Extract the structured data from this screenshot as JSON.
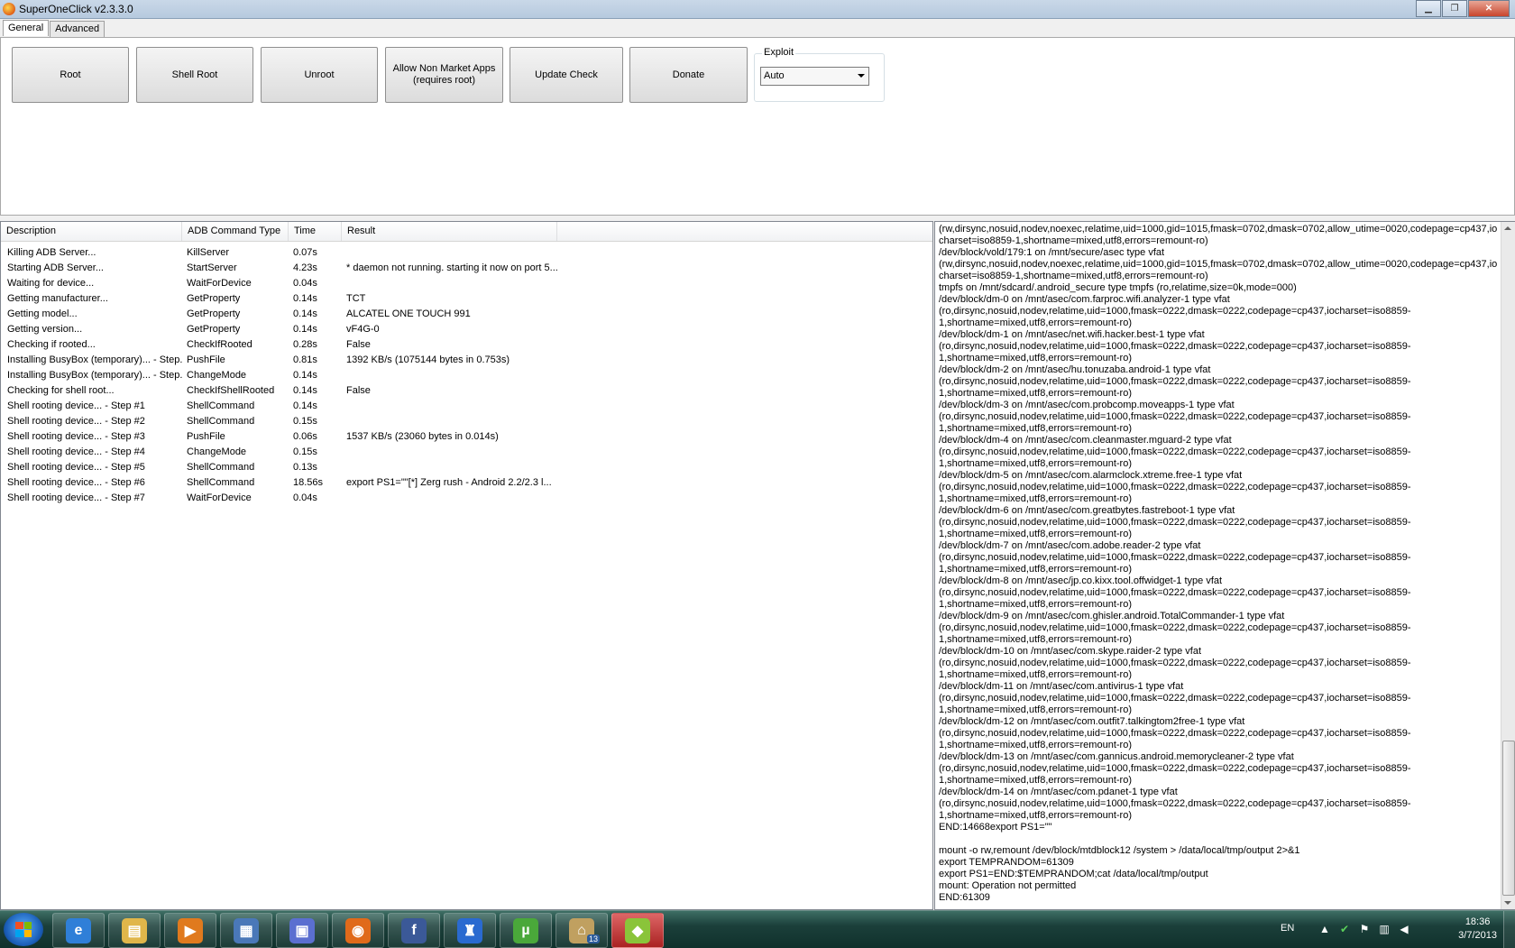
{
  "window": {
    "title": "SuperOneClick v2.3.3.0",
    "min_icon": "minimize-icon",
    "max_icon": "maximize-icon",
    "close_icon": "close-icon"
  },
  "tabs": [
    {
      "label": "General",
      "active": true
    },
    {
      "label": "Advanced",
      "active": false
    }
  ],
  "buttons": {
    "root": "Root",
    "shell_root": "Shell Root",
    "unroot": "Unroot",
    "allow_non_market_line1": "Allow Non Market Apps",
    "allow_non_market_line2": "(requires root)",
    "update_check": "Update Check",
    "donate": "Donate"
  },
  "exploit": {
    "label": "Exploit",
    "value": "Auto"
  },
  "listview": {
    "columns": [
      "Description",
      "ADB Command Type",
      "Time",
      "Result"
    ],
    "rows": [
      [
        "Killing ADB Server...",
        "KillServer",
        "0.07s",
        ""
      ],
      [
        "Starting ADB Server...",
        "StartServer",
        "4.23s",
        "* daemon not running. starting it now on port 5..."
      ],
      [
        "Waiting for device...",
        "WaitForDevice",
        "0.04s",
        ""
      ],
      [
        "Getting manufacturer...",
        "GetProperty",
        "0.14s",
        "TCT"
      ],
      [
        "Getting model...",
        "GetProperty",
        "0.14s",
        "ALCATEL ONE TOUCH 991"
      ],
      [
        "Getting version...",
        "GetProperty",
        "0.14s",
        "vF4G-0"
      ],
      [
        "Checking if rooted...",
        "CheckIfRooted",
        "0.28s",
        "False"
      ],
      [
        "Installing BusyBox (temporary)... - Step...",
        "PushFile",
        "0.81s",
        "1392 KB/s (1075144 bytes in 0.753s)"
      ],
      [
        "Installing BusyBox (temporary)... - Step...",
        "ChangeMode",
        "0.14s",
        ""
      ],
      [
        "Checking for shell root...",
        "CheckIfShellRooted",
        "0.14s",
        "False"
      ],
      [
        "Shell rooting device... - Step #1",
        "ShellCommand",
        "0.14s",
        ""
      ],
      [
        "Shell rooting device... - Step #2",
        "ShellCommand",
        "0.15s",
        ""
      ],
      [
        "Shell rooting device... - Step #3",
        "PushFile",
        "0.06s",
        "1537 KB/s (23060 bytes in 0.014s)"
      ],
      [
        "Shell rooting device... - Step #4",
        "ChangeMode",
        "0.15s",
        ""
      ],
      [
        "Shell rooting device... - Step #5",
        "ShellCommand",
        "0.13s",
        ""
      ],
      [
        "Shell rooting device... - Step #6",
        "ShellCommand",
        "18.56s",
        "export PS1=\"\"[*] Zerg rush - Android 2.2/2.3 l..."
      ],
      [
        "Shell rooting device... - Step #7",
        "WaitForDevice",
        "0.04s",
        ""
      ]
    ]
  },
  "log": {
    "text": "(rw,dirsync,nosuid,nodev,noexec,relatime,uid=1000,gid=1015,fmask=0702,dmask=0702,allow_utime=0020,codepage=cp437,iocharset=iso8859-1,shortname=mixed,utf8,errors=remount-ro)\n/dev/block/vold/179:1 on /mnt/secure/asec type vfat\n(rw,dirsync,nosuid,nodev,noexec,relatime,uid=1000,gid=1015,fmask=0702,dmask=0702,allow_utime=0020,codepage=cp437,iocharset=iso8859-1,shortname=mixed,utf8,errors=remount-ro)\ntmpfs on /mnt/sdcard/.android_secure type tmpfs (ro,relatime,size=0k,mode=000)\n/dev/block/dm-0 on /mnt/asec/com.farproc.wifi.analyzer-1 type vfat\n(ro,dirsync,nosuid,nodev,relatime,uid=1000,fmask=0222,dmask=0222,codepage=cp437,iocharset=iso8859-\n1,shortname=mixed,utf8,errors=remount-ro)\n/dev/block/dm-1 on /mnt/asec/net.wifi.hacker.best-1 type vfat\n(ro,dirsync,nosuid,nodev,relatime,uid=1000,fmask=0222,dmask=0222,codepage=cp437,iocharset=iso8859-\n1,shortname=mixed,utf8,errors=remount-ro)\n/dev/block/dm-2 on /mnt/asec/hu.tonuzaba.android-1 type vfat\n(ro,dirsync,nosuid,nodev,relatime,uid=1000,fmask=0222,dmask=0222,codepage=cp437,iocharset=iso8859-\n1,shortname=mixed,utf8,errors=remount-ro)\n/dev/block/dm-3 on /mnt/asec/com.probcomp.moveapps-1 type vfat\n(ro,dirsync,nosuid,nodev,relatime,uid=1000,fmask=0222,dmask=0222,codepage=cp437,iocharset=iso8859-\n1,shortname=mixed,utf8,errors=remount-ro)\n/dev/block/dm-4 on /mnt/asec/com.cleanmaster.mguard-2 type vfat\n(ro,dirsync,nosuid,nodev,relatime,uid=1000,fmask=0222,dmask=0222,codepage=cp437,iocharset=iso8859-\n1,shortname=mixed,utf8,errors=remount-ro)\n/dev/block/dm-5 on /mnt/asec/com.alarmclock.xtreme.free-1 type vfat\n(ro,dirsync,nosuid,nodev,relatime,uid=1000,fmask=0222,dmask=0222,codepage=cp437,iocharset=iso8859-\n1,shortname=mixed,utf8,errors=remount-ro)\n/dev/block/dm-6 on /mnt/asec/com.greatbytes.fastreboot-1 type vfat\n(ro,dirsync,nosuid,nodev,relatime,uid=1000,fmask=0222,dmask=0222,codepage=cp437,iocharset=iso8859-\n1,shortname=mixed,utf8,errors=remount-ro)\n/dev/block/dm-7 on /mnt/asec/com.adobe.reader-2 type vfat\n(ro,dirsync,nosuid,nodev,relatime,uid=1000,fmask=0222,dmask=0222,codepage=cp437,iocharset=iso8859-\n1,shortname=mixed,utf8,errors=remount-ro)\n/dev/block/dm-8 on /mnt/asec/jp.co.kixx.tool.offwidget-1 type vfat\n(ro,dirsync,nosuid,nodev,relatime,uid=1000,fmask=0222,dmask=0222,codepage=cp437,iocharset=iso8859-\n1,shortname=mixed,utf8,errors=remount-ro)\n/dev/block/dm-9 on /mnt/asec/com.ghisler.android.TotalCommander-1 type vfat\n(ro,dirsync,nosuid,nodev,relatime,uid=1000,fmask=0222,dmask=0222,codepage=cp437,iocharset=iso8859-\n1,shortname=mixed,utf8,errors=remount-ro)\n/dev/block/dm-10 on /mnt/asec/com.skype.raider-2 type vfat\n(ro,dirsync,nosuid,nodev,relatime,uid=1000,fmask=0222,dmask=0222,codepage=cp437,iocharset=iso8859-\n1,shortname=mixed,utf8,errors=remount-ro)\n/dev/block/dm-11 on /mnt/asec/com.antivirus-1 type vfat\n(ro,dirsync,nosuid,nodev,relatime,uid=1000,fmask=0222,dmask=0222,codepage=cp437,iocharset=iso8859-\n1,shortname=mixed,utf8,errors=remount-ro)\n/dev/block/dm-12 on /mnt/asec/com.outfit7.talkingtom2free-1 type vfat\n(ro,dirsync,nosuid,nodev,relatime,uid=1000,fmask=0222,dmask=0222,codepage=cp437,iocharset=iso8859-\n1,shortname=mixed,utf8,errors=remount-ro)\n/dev/block/dm-13 on /mnt/asec/com.gannicus.android.memorycleaner-2 type vfat\n(ro,dirsync,nosuid,nodev,relatime,uid=1000,fmask=0222,dmask=0222,codepage=cp437,iocharset=iso8859-\n1,shortname=mixed,utf8,errors=remount-ro)\n/dev/block/dm-14 on /mnt/asec/com.pdanet-1 type vfat\n(ro,dirsync,nosuid,nodev,relatime,uid=1000,fmask=0222,dmask=0222,codepage=cp437,iocharset=iso8859-\n1,shortname=mixed,utf8,errors=remount-ro)\nEND:14668export PS1=\"\"\n\nmount -o rw,remount /dev/block/mtdblock12 /system > /data/local/tmp/output 2>&1\nexport TEMPRANDOM=61309\nexport PS1=END:$TEMPRANDOM;cat /data/local/tmp/output\nmount: Operation not permitted\nEND:61309"
  },
  "taskbar": {
    "items": [
      {
        "name": "ie-icon",
        "glyph": "e",
        "color": "#2f7fd8"
      },
      {
        "name": "folder-icon",
        "glyph": "▤",
        "color": "#e0b64a"
      },
      {
        "name": "media-player-icon",
        "glyph": "▶",
        "color": "#e07a1e"
      },
      {
        "name": "network-icon",
        "glyph": "▦",
        "color": "#4a78b8"
      },
      {
        "name": "app-window-icon",
        "glyph": "▣",
        "color": "#5b6fd0"
      },
      {
        "name": "firefox-icon",
        "glyph": "◉",
        "color": "#e06a1a"
      },
      {
        "name": "facebook-icon",
        "glyph": "f",
        "color": "#3b5998"
      },
      {
        "name": "lamp-icon",
        "glyph": "♜",
        "color": "#2a6ad0"
      },
      {
        "name": "utorrent-icon",
        "glyph": "µ",
        "color": "#4aa83a"
      },
      {
        "name": "home-icon",
        "glyph": "⌂",
        "color": "#c0a060",
        "badge": "13"
      },
      {
        "name": "android-icon",
        "glyph": "◆",
        "color": "#8ac43a",
        "active": true
      }
    ],
    "language": "EN",
    "time": "18:36",
    "date": "3/7/2013"
  }
}
